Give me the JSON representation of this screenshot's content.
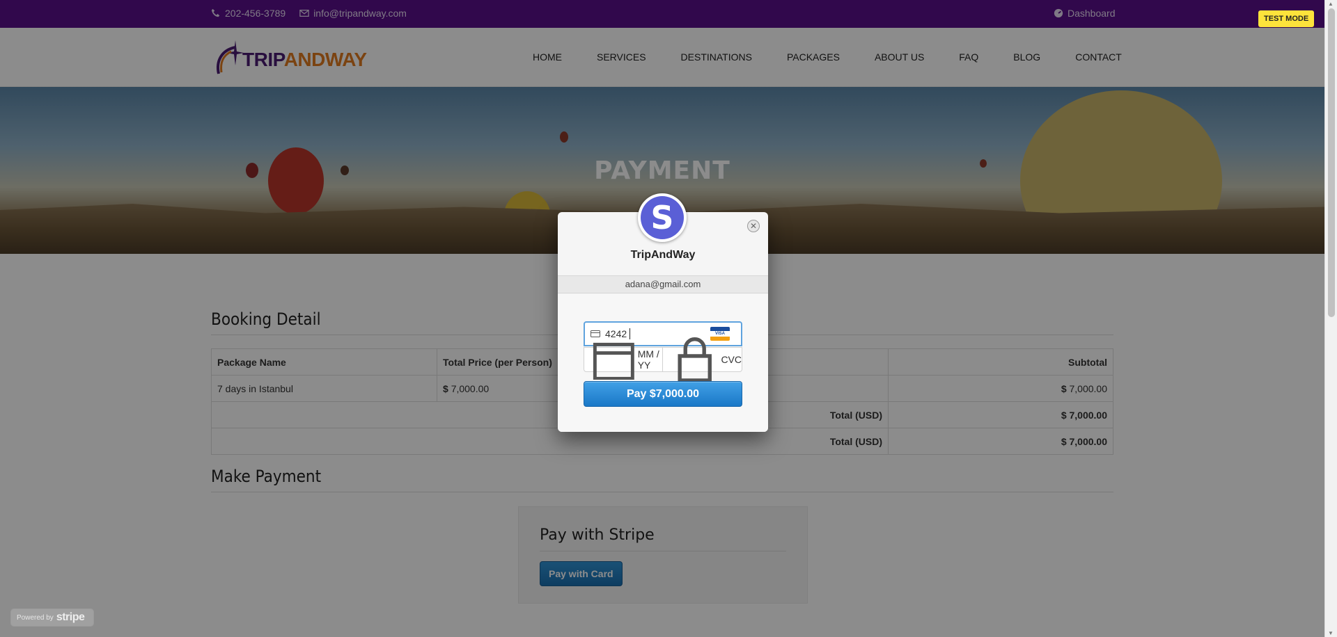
{
  "topbar": {
    "phone": "202-456-3789",
    "email": "info@tripandway.com",
    "dashboard": "Dashboard"
  },
  "logo": {
    "part1": "TRIP",
    "part2": "ANDWAY"
  },
  "nav": [
    "HOME",
    "SERVICES",
    "DESTINATIONS",
    "PACKAGES",
    "ABOUT US",
    "FAQ",
    "BLOG",
    "CONTACT"
  ],
  "banner": {
    "title": "PAYMENT"
  },
  "booking": {
    "title": "Booking Detail",
    "headers": [
      "Package Name",
      "Total Price (per Person)",
      "Subtotal"
    ],
    "row": {
      "name": "7 days in Istanbul",
      "price": "7,000.00",
      "subtotal": "7,000.00",
      "currency": "$"
    },
    "total1_label": "Total (USD)",
    "total1_value": "$ 7,000.00",
    "total2_label": "Total (USD)",
    "total2_value": "$ 7,000.00"
  },
  "payment": {
    "title": "Make Payment",
    "stripe_title": "Pay with Stripe",
    "pay_with_card": "Pay with Card"
  },
  "modal": {
    "merchant": "TripAndWay",
    "email": "adana@gmail.com",
    "card_number": "4242",
    "expiry_placeholder": "MM / YY",
    "cvc_placeholder": "CVC",
    "pay_button": "Pay $7,000.00",
    "avatar_letter": "S",
    "visa_label": "VISA"
  },
  "test_mode": "TEST MODE",
  "powered": {
    "prefix": "Powered by",
    "brand": "stripe"
  }
}
